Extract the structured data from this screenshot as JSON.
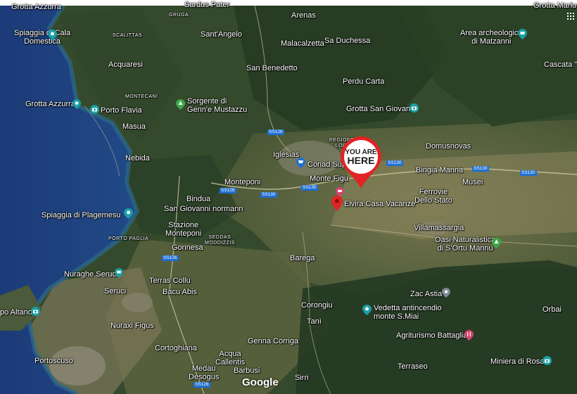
{
  "map": {
    "attribution": "Google",
    "you_are_here": [
      "YOU ARE",
      "HERE"
    ],
    "labels": {
      "grotta_azzurra_top": "Grotta Azzurra",
      "gruga": "GRUGA",
      "sardus_pater": "Sardus Pater",
      "arenas": "Arenas",
      "grotta_mariu": "Grotta Mariu",
      "spiaggia_cala_domestica": [
        "Spiaggia di Cala",
        "Domestica"
      ],
      "scalittas": "SCALITTAS",
      "sant_angelo": "Sant'Angelo",
      "malacalzetta": "Malacalzetta",
      "sa_duchessa": "Sa Duchessa",
      "area_matzanni": [
        "Area archeologica",
        "di Matzanni"
      ],
      "acquaresi": "Acquaresi",
      "san_benedetto": "San Benedetto",
      "cascata": "Cascata \"S",
      "perdu_carta": "Perdu Carta",
      "montecani": "MONTECANI",
      "grotta_azzurra": "Grotta Azzurra",
      "porto_flavia": "Porto Flavia",
      "sorgente": [
        "Sorgente di",
        "Genn'e Mustazzu"
      ],
      "grotta_san_giovanni": "Grotta San Giovanni",
      "masua": "Masua",
      "nebida": "Nebida",
      "regione": [
        "REGIONE",
        "LORI"
      ],
      "domusnovas": "Domusnovas",
      "iglesias": "Iglesias",
      "conad": "Conad Supe",
      "monte_figu": "Monte Figu",
      "bingia_manna": "Bingia Manna",
      "musei": "Musei",
      "monteponi": "Monteponi",
      "bindua": "Bindua",
      "elvira": "Elvira Casa Vacanze",
      "ferrovie": [
        "Ferrovie",
        "Dello Stato"
      ],
      "san_giovanni_normanna": "San Giovanni normann",
      "spiaggia_plagemesu": "Spiaggia di Plagemesu",
      "stazione_monteponi": [
        "Stazione",
        "Monteponi"
      ],
      "villamassargia": "Villamassargia",
      "porto_paglia": "PORTO PAGLIA",
      "seddas_moddizzis": [
        "SEDDAS",
        "MODDIZZIS"
      ],
      "oasi": [
        "Oasi Naturalistica",
        "di S'Ortu Mannu"
      ],
      "gonnesa": "Gonnesa",
      "barega": "Barega",
      "nuraghe_seruci": "Nuraghe Seruci",
      "terras_collu": "Terras Collu",
      "bacu_abis": "Bacu Abis",
      "seruci": "Seruci",
      "zac_astia": "Zac Astia",
      "capo_altano": "po Altano",
      "corongiu": "Corongiu",
      "vedetta": [
        "Vedetta antincendio",
        "monte S.Miai"
      ],
      "orbai": "Orbai",
      "nuraxi_figus": "Nuraxi Figus",
      "tani": "Tanì",
      "agriturismo": "Agriturismo Battaglia",
      "cortoghiana": "Cortoghiana",
      "genna_corriga": "Genna Corriga",
      "acqua_callentis": [
        "Acqua",
        "Callentis"
      ],
      "miniera_rosas": "Miniera di Rosas",
      "portoscuso": "Portoscuso",
      "terraseo": "Terraseo",
      "medau_desogus": [
        "Medau",
        "Desogus"
      ],
      "barbusi": "Barbusi",
      "sirri": "Sirri"
    },
    "roads": {
      "ss126_a": "SS126",
      "ss126_b": "SS126",
      "ss126_c": "SS126",
      "ss126_d": "SS126",
      "ss130_a": "SS130",
      "ss130_b": "SS130",
      "ss130_c": "SS130",
      "ss130_d": "SS130",
      "ss130_e": "SS130"
    },
    "colors": {
      "sea": "#1d3f7a",
      "poi_teal": "#1a9fa5",
      "poi_green": "#3ea84a",
      "poi_pink": "#d1456d",
      "poi_grey": "#7d8b95",
      "marker_red": "#e02424",
      "road_blue": "#1f6fd1"
    }
  }
}
